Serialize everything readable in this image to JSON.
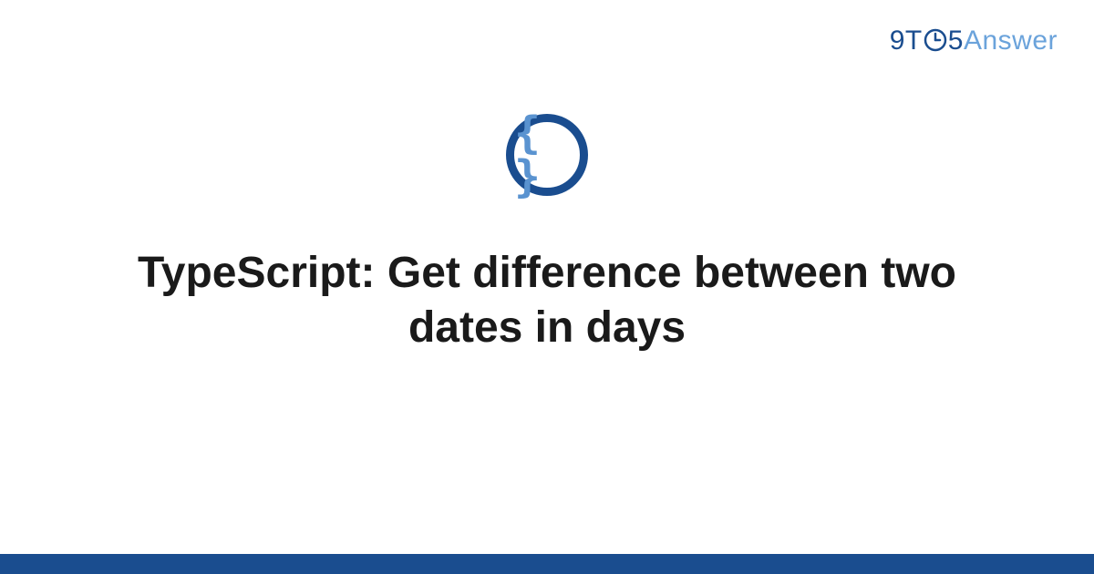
{
  "logo": {
    "part1": "9T",
    "part2": "5",
    "part3": "Answer"
  },
  "icon": {
    "symbol": "{ }",
    "name": "code-braces"
  },
  "title": "TypeScript: Get difference between two dates in days",
  "colors": {
    "primary": "#1a4d8f",
    "secondary": "#6ba3db",
    "icon_fill": "#5a93d0"
  }
}
